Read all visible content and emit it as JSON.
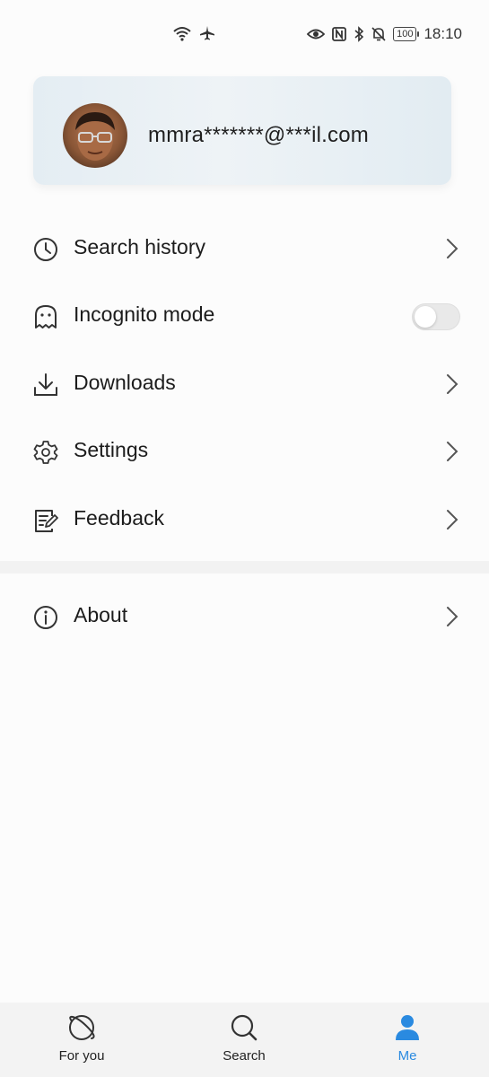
{
  "status_bar": {
    "time": "18:10",
    "battery": "100"
  },
  "account": {
    "email": "mmra*******@***il.com"
  },
  "menu": {
    "search_history": "Search history",
    "incognito": "Incognito mode",
    "downloads": "Downloads",
    "settings": "Settings",
    "feedback": "Feedback",
    "about": "About"
  },
  "incognito_enabled": false,
  "bottom_nav": {
    "for_you": "For you",
    "search": "Search",
    "me": "Me",
    "active": "me",
    "accent_color": "#2a8ae0"
  }
}
